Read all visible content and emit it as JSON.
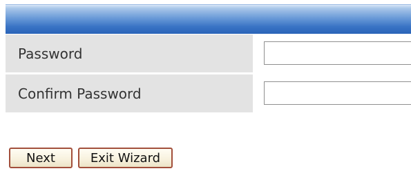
{
  "form": {
    "password_label": "Password",
    "password_value": "",
    "confirm_label": "Confirm Password",
    "confirm_value": ""
  },
  "buttons": {
    "next_label": "Next",
    "exit_label": "Exit Wizard"
  },
  "colors": {
    "header_bar": "#3a74c5",
    "label_background": "#e3e3e3",
    "button_border": "#a24f3b"
  }
}
